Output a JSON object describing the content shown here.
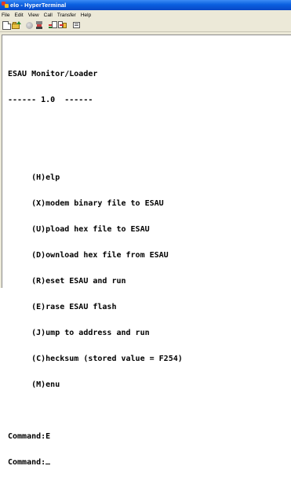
{
  "window": {
    "title": "elo - HyperTerminal"
  },
  "menubar": {
    "items": [
      "File",
      "Edit",
      "View",
      "Call",
      "Transfer",
      "Help"
    ]
  },
  "toolbar": {
    "icons": [
      "new-icon",
      "open-icon",
      "disconnect-icon",
      "properties-icon",
      "send-icon",
      "receive-icon",
      "connect-icon"
    ]
  },
  "terminal": {
    "lines": [
      "ESAU Monitor/Loader",
      "------ 1.0  ------",
      "",
      "",
      "     (H)elp",
      "     (X)modem binary file to ESAU",
      "     (U)pload hex file to ESAU",
      "     (D)ownload hex file from ESAU",
      "     (R)eset ESAU and run",
      "     (E)rase ESAU flash",
      "     (J)ump to address and run",
      "     (C)hecksum (stored value = F254)",
      "     (M)enu",
      "",
      "Command:E",
      "Command:"
    ]
  }
}
